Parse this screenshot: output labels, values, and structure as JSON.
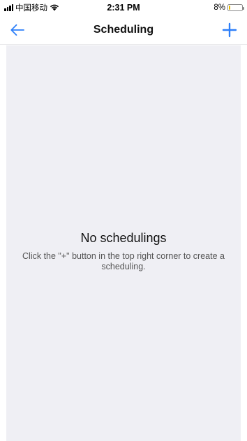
{
  "status_bar": {
    "carrier": "中国移动",
    "time": "2:31 PM",
    "battery_text": "8%",
    "battery_level": 0.08,
    "battery_color": "#e5b700"
  },
  "nav": {
    "title": "Scheduling",
    "back_icon": "arrow-left-icon",
    "add_icon": "plus-icon",
    "accent_color": "#2d7ff9"
  },
  "empty_state": {
    "title": "No schedulings",
    "description": "Click the \"+\" button in the top right corner to create a scheduling."
  }
}
